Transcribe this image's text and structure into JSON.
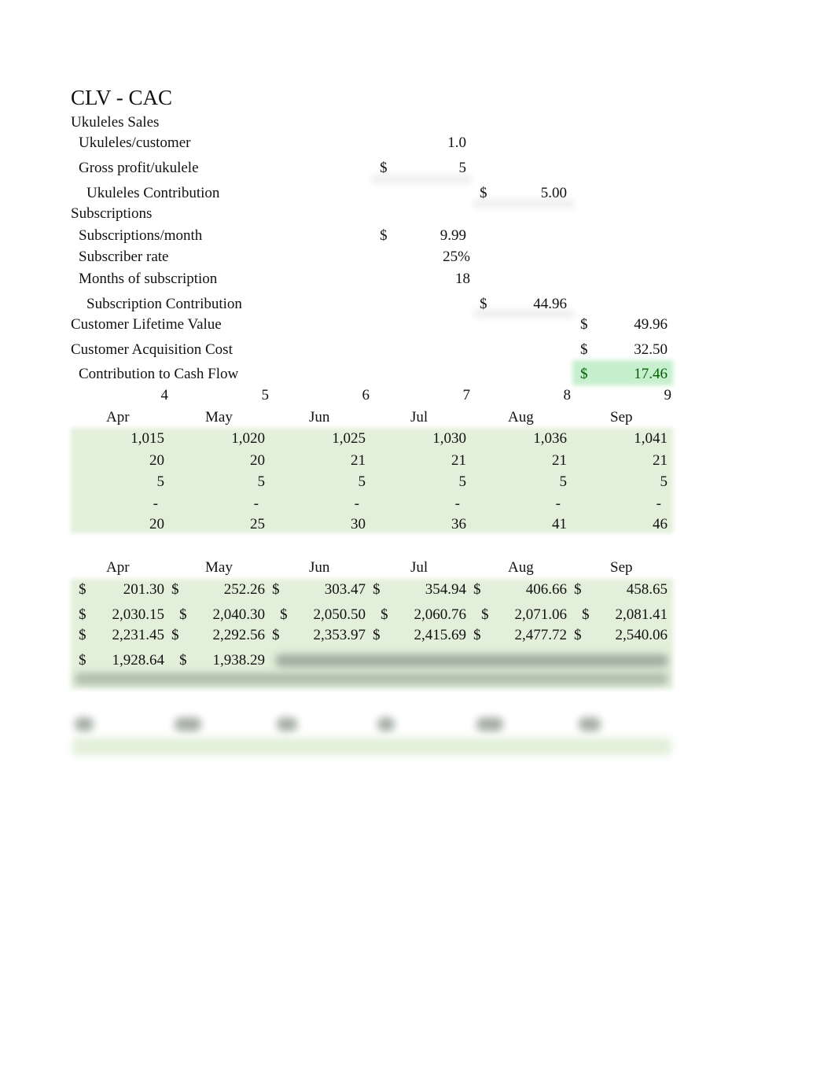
{
  "title": "CLV - CAC",
  "ukuleles": {
    "section_label": "Ukuleles Sales",
    "per_customer_label": "Ukuleles/customer",
    "per_customer_value": "1.0",
    "gross_profit_label": "Gross profit/ukulele",
    "gross_profit_currency": "$",
    "gross_profit_value": "5",
    "contribution_label": "Ukuleles Contribution",
    "contribution_currency": "$",
    "contribution_value": "5.00"
  },
  "subscriptions": {
    "section_label": "Subscriptions",
    "per_month_label": "Subscriptions/month",
    "per_month_currency": "$",
    "per_month_value": "9.99",
    "rate_label": "Subscriber rate",
    "rate_value": "25%",
    "months_label": "Months of subscription",
    "months_value": "18",
    "contribution_label": "Subscription Contribution",
    "contribution_currency": "$",
    "contribution_value": "44.96"
  },
  "summary": {
    "clv_label": "Customer Lifetime Value",
    "clv_currency": "$",
    "clv_value": "49.96",
    "cac_label": "Customer Acquisition Cost",
    "cac_currency": "$",
    "cac_value": "32.50",
    "cash_flow_label": "Contribution to Cash Flow",
    "cash_flow_currency": "$",
    "cash_flow_value": "17.46",
    "highlight_color": "#c6efce",
    "highlight_text_color": "#006100"
  },
  "table1": {
    "month_numbers": [
      "4",
      "5",
      "6",
      "7",
      "8",
      "9"
    ],
    "months": [
      "Apr",
      "May",
      "Jun",
      "Jul",
      "Aug",
      "Sep"
    ],
    "rows": [
      [
        "1,015",
        "1,020",
        "1,025",
        "1,030",
        "1,036",
        "1,041"
      ],
      [
        "20",
        "20",
        "21",
        "21",
        "21",
        "21"
      ],
      [
        "5",
        "5",
        "5",
        "5",
        "5",
        "5"
      ],
      [
        "-",
        "-",
        "-",
        "-",
        "-",
        "-"
      ],
      [
        "20",
        "25",
        "30",
        "36",
        "41",
        "46"
      ]
    ],
    "fill_color": "#e2efda"
  },
  "table2": {
    "months": [
      "Apr",
      "May",
      "Jun",
      "Jul",
      "Aug",
      "Sep"
    ],
    "currency": "$",
    "rows": [
      [
        "201.30",
        "252.26",
        "303.47",
        "354.94",
        "406.66",
        "458.65"
      ],
      [
        "2,030.15",
        "2,040.30",
        "2,050.50",
        "2,060.76",
        "2,071.06",
        "2,081.41"
      ],
      [
        "2,231.45",
        "2,292.56",
        "2,353.97",
        "2,415.69",
        "2,477.72",
        "2,540.06"
      ],
      [
        "1,928.64",
        "1,938.29"
      ]
    ]
  }
}
